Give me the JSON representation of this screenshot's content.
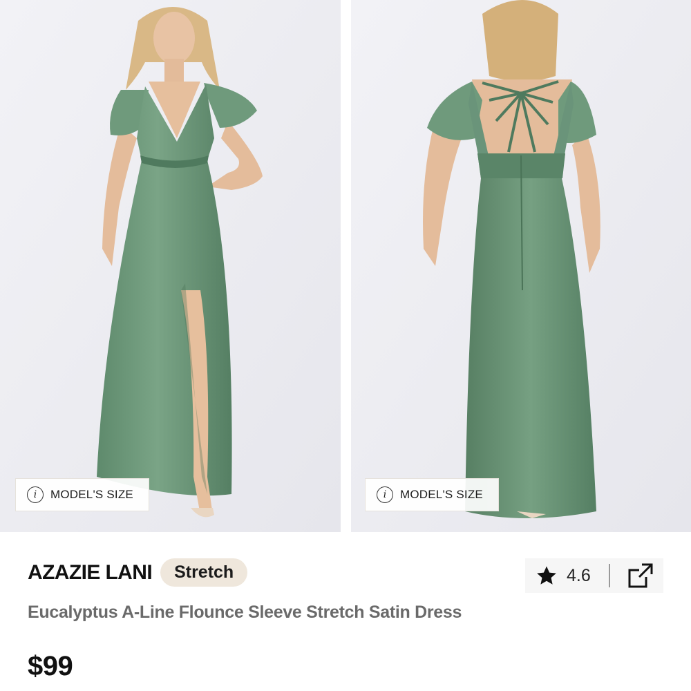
{
  "gallery": {
    "front_chip_label": "MODEL'S SIZE",
    "back_chip_label": "MODEL'S SIZE",
    "info_glyph": "i"
  },
  "product": {
    "brand": "AZAZIE LANI",
    "badge": "Stretch",
    "name": "Eucalyptus A-Line Flounce Sleeve Stretch Satin Dress",
    "price": "$99",
    "rating": "4.6"
  },
  "icons": {
    "info": "info-icon",
    "star": "star-icon",
    "share": "share-icon"
  },
  "colors": {
    "dress": "#6a9478",
    "dress_dark": "#4f7a5e",
    "badge_bg": "#efe7dc",
    "photo_bg": "#ededf1",
    "name_text": "#6a6a6a"
  }
}
